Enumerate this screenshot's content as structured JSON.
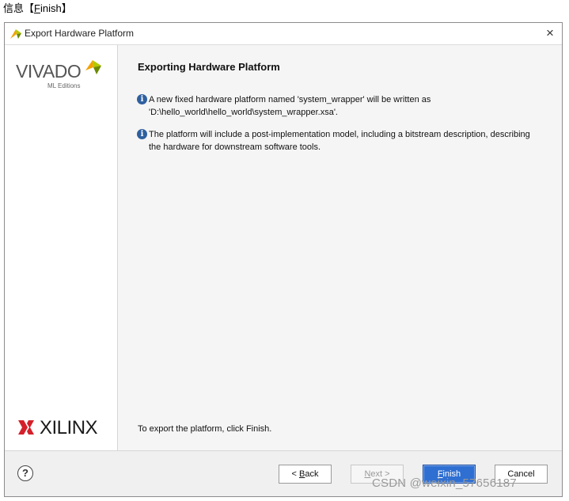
{
  "caption": {
    "prefix": "信息【",
    "underlined": "F",
    "rest": "inish】"
  },
  "dialog": {
    "title": "Export Hardware Platform",
    "close_glyph": "×"
  },
  "left_panel": {
    "vivado_text": "VIVADO",
    "vivado_sub": "ML Editions",
    "xilinx_text": "XILINX"
  },
  "content": {
    "heading": "Exporting Hardware Platform",
    "info1_line1": "A new fixed hardware platform named 'system_wrapper' will be written as",
    "info1_line2": "'D:\\hello_world\\hello_world\\system_wrapper.xsa'.",
    "info2_line1": "The platform will include a post-implementation model, including a bitstream description, describing",
    "info2_line2": "the hardware for downstream software tools.",
    "footer": "To export the platform, click Finish."
  },
  "buttons": {
    "help": "?",
    "back_prefix": "< ",
    "back_u": "B",
    "back_rest": "ack",
    "next_u": "N",
    "next_rest": "ext >",
    "finish_u": "F",
    "finish_rest": "inish",
    "cancel": "Cancel"
  },
  "watermark": "CSDN @weixin_57656187",
  "colors": {
    "accent": "#2f6fd2",
    "info_icon": "#2f5f9f",
    "panel_bg": "#f5f5f5"
  },
  "icons": [
    "vivado-leaf-icon",
    "close-icon",
    "info-icon",
    "help-icon",
    "xilinx-icon"
  ]
}
